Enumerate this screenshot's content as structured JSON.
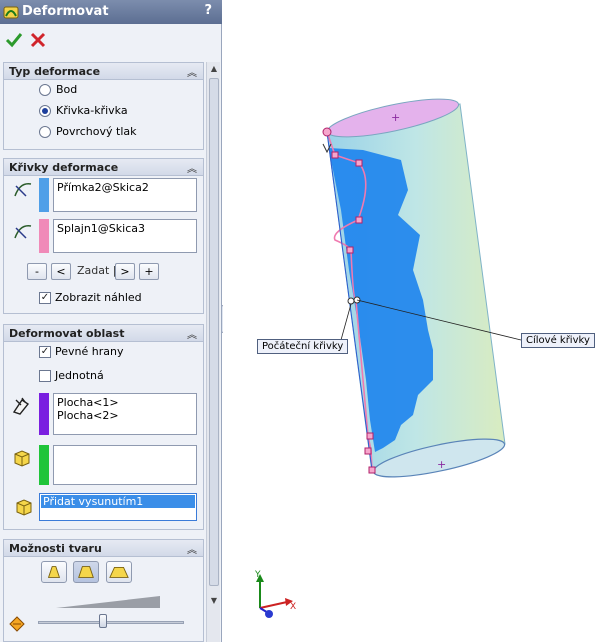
{
  "panel": {
    "title": "Deformovat",
    "help": "?",
    "ok_label": "✔",
    "cancel_label": "✖"
  },
  "type_section": {
    "title": "Typ deformace",
    "options": [
      "Bod",
      "Křivka-křivka",
      "Povrchový tlak"
    ],
    "selected": "Křivka-křivka"
  },
  "curves_section": {
    "title": "Křivky deformace",
    "list1": "Přímka2@Skica2",
    "list2": "Splajn1@Skica3",
    "list1_color": "#4f9fe8",
    "list2_color": "#f08ab8",
    "minus": "-",
    "prev": "<",
    "zadat": "Zadat |",
    "next": ">",
    "plus": "+",
    "preview_label": "Zobrazit náhled",
    "preview_checked": true
  },
  "region_section": {
    "title": "Deformovat oblast",
    "fixed_edges_label": "Pevné hrany",
    "fixed_edges_checked": true,
    "uniform_label": "Jednotná",
    "uniform_checked": false,
    "faces": [
      "Plocha<1>",
      "Plocha<2>"
    ],
    "faces_color": "#7a1fe0",
    "empty_color": "#1fc43a",
    "bodies_item": "Přidat vysunutím1"
  },
  "shape_section": {
    "title": "Možnosti tvaru"
  },
  "viewport": {
    "label_start": "Počáteční křivky",
    "label_target": "Cílové křivky",
    "axis_x": "X",
    "axis_y": "Y"
  }
}
